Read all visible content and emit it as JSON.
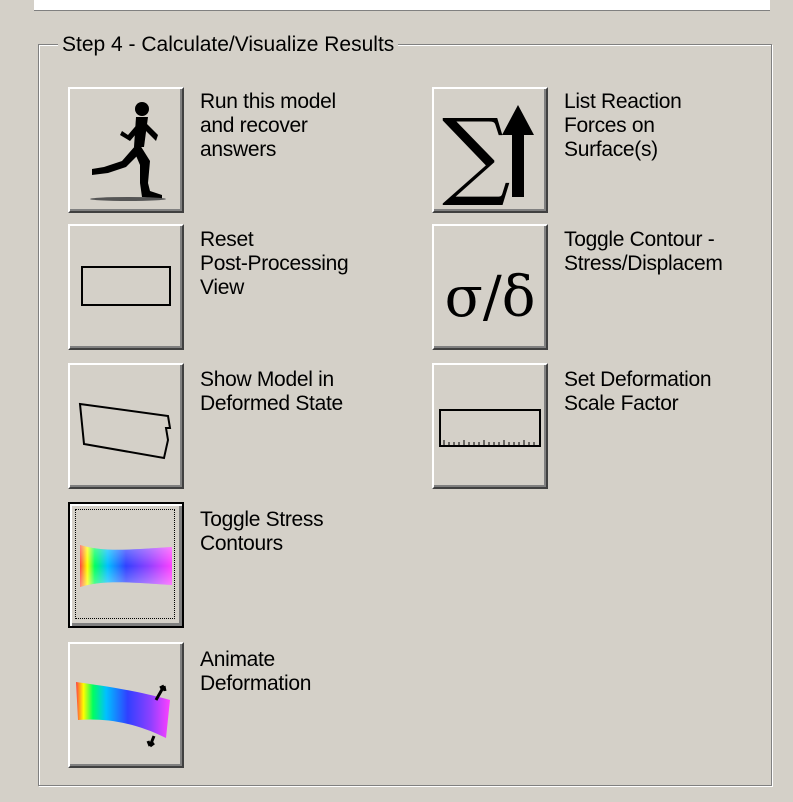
{
  "group": {
    "title": "Step 4 - Calculate/Visualize Results"
  },
  "buttons": {
    "run": {
      "icon": "runner-icon",
      "label": "Run this model\nand recover\nanswers"
    },
    "reaction": {
      "icon": "sum-arrow-icon",
      "label": "List Reaction\nForces on\nSurface(s)"
    },
    "reset": {
      "icon": "rectangle-icon",
      "label": "Reset\nPost-Processing\nView"
    },
    "toggle_contour": {
      "icon": "sigma-delta-icon",
      "label": "Toggle Contour -\nStress/Displacem",
      "glyph": "σ/δ"
    },
    "deformed": {
      "icon": "deformed-shape-icon",
      "label": "Show Model in\nDeformed State"
    },
    "scale": {
      "icon": "ruler-icon",
      "label": "Set Deformation\nScale Factor"
    },
    "stress": {
      "icon": "stress-contour-icon",
      "label": "Toggle Stress\nContours"
    },
    "animate": {
      "icon": "animation-icon",
      "label": "Animate\nDeformation"
    }
  },
  "colors": {
    "face": "#d4d0c8",
    "shadow": "#808080",
    "highlight": "#ffffff"
  }
}
